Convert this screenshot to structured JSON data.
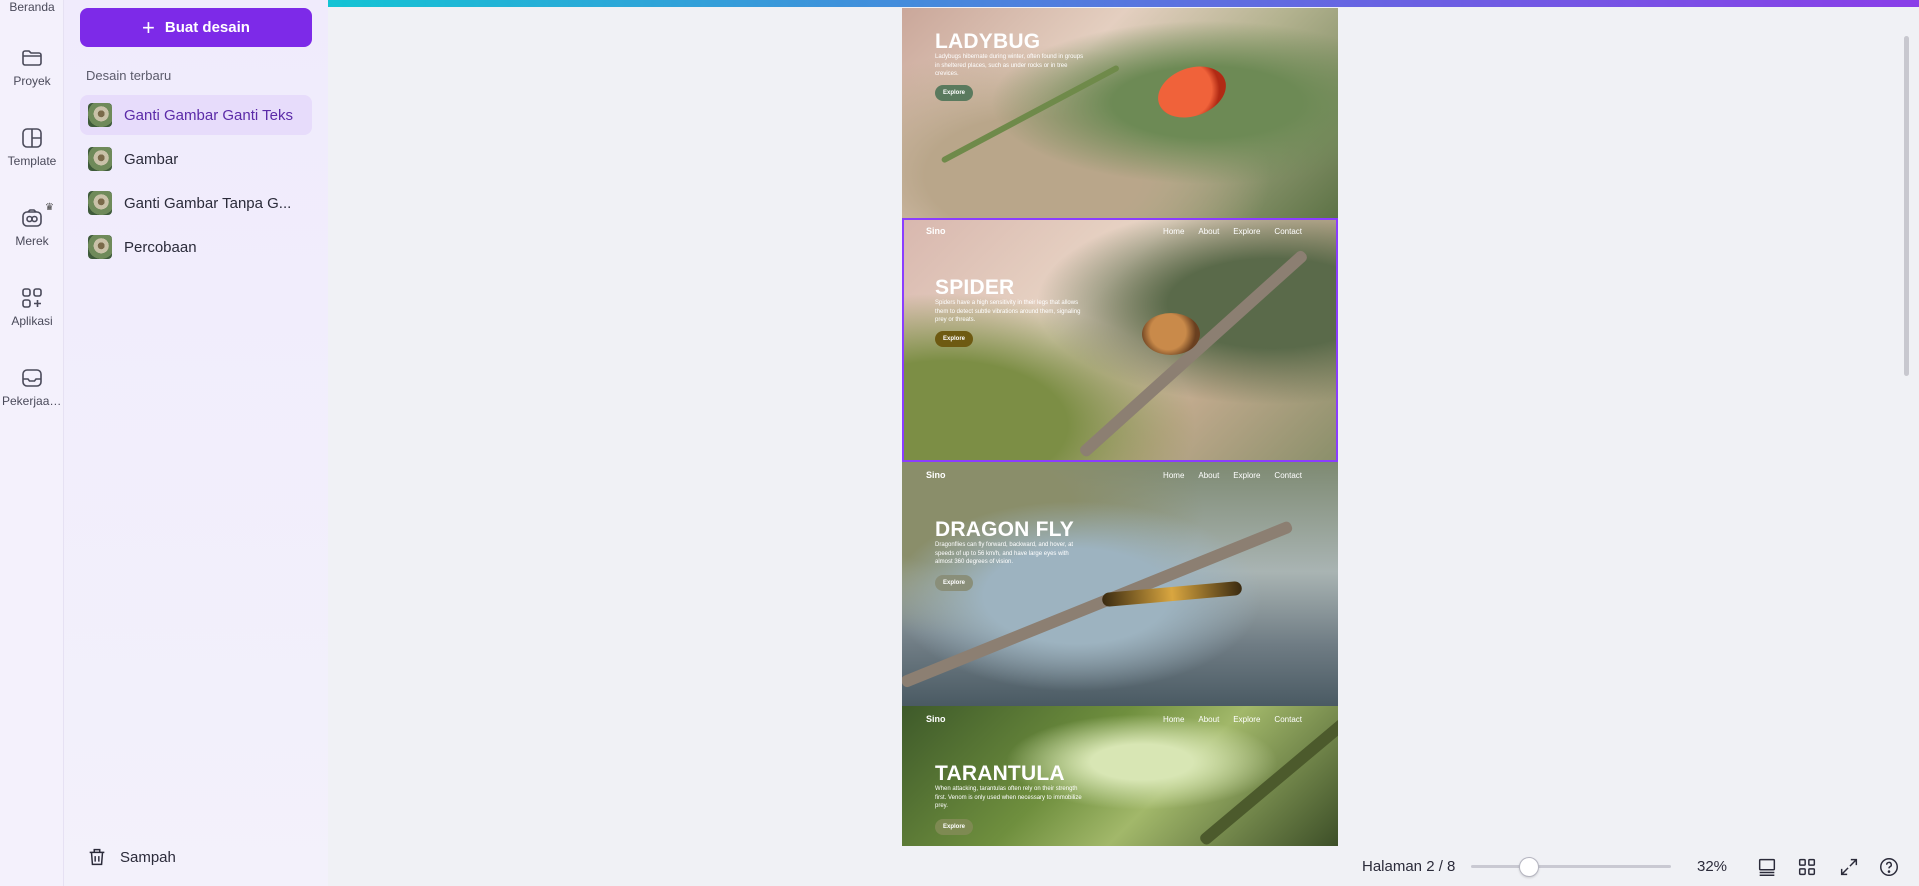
{
  "rail": {
    "items": [
      {
        "label": "Beranda",
        "icon": "home-icon"
      },
      {
        "label": "Proyek",
        "icon": "folder-icon"
      },
      {
        "label": "Template",
        "icon": "template-icon"
      },
      {
        "label": "Merek",
        "icon": "brand-icon"
      },
      {
        "label": "Aplikasi",
        "icon": "apps-icon"
      },
      {
        "label": "Pekerjaan ...",
        "icon": "inbox-icon"
      }
    ]
  },
  "panel": {
    "create_label": "Buat desain",
    "section_title": "Desain terbaru",
    "recent": [
      {
        "label": "Ganti Gambar Ganti Teks",
        "active": true
      },
      {
        "label": "Gambar",
        "active": false
      },
      {
        "label": "Ganti Gambar Tanpa G...",
        "active": false
      },
      {
        "label": "Percobaan",
        "active": false
      }
    ],
    "trash_label": "Sampah"
  },
  "canvas": {
    "nav_links": [
      "Home",
      "About",
      "Explore",
      "Contact"
    ],
    "brand": "Sino",
    "pages": [
      {
        "title": "LADYBUG",
        "text": "Ladybugs hibernate during winter, often found in groups in sheltered places, such as under rocks or in tree crevices.",
        "button": "Explore",
        "button_color": "#5a7a5e"
      },
      {
        "title": "SPIDER",
        "text": "Spiders have a high sensitivity in their legs that allows them to detect subtle vibrations around them, signaling prey or threats.",
        "button": "Explore",
        "button_color": "#6e5a12"
      },
      {
        "title": "DRAGON FLY",
        "text": "Dragonflies can fly forward, backward, and hover, at speeds of up to 56 km/h, and have large eyes with almost 360 degrees of vision.",
        "button": "Explore",
        "button_color": "#8a8f7a"
      },
      {
        "title": "TARANTULA",
        "text": "When attacking, tarantulas often rely on their strength first. Venom is only used when necessary to immobilize prey.",
        "button": "Explore",
        "button_color": "#7e8a52"
      }
    ]
  },
  "bottom_bar": {
    "page_indicator": "Halaman 2 / 8",
    "zoom_value": "32%",
    "zoom_level_fraction": 0.32
  },
  "colors": {
    "accent": "#7d2ae8",
    "selection": "#8b3dff"
  }
}
